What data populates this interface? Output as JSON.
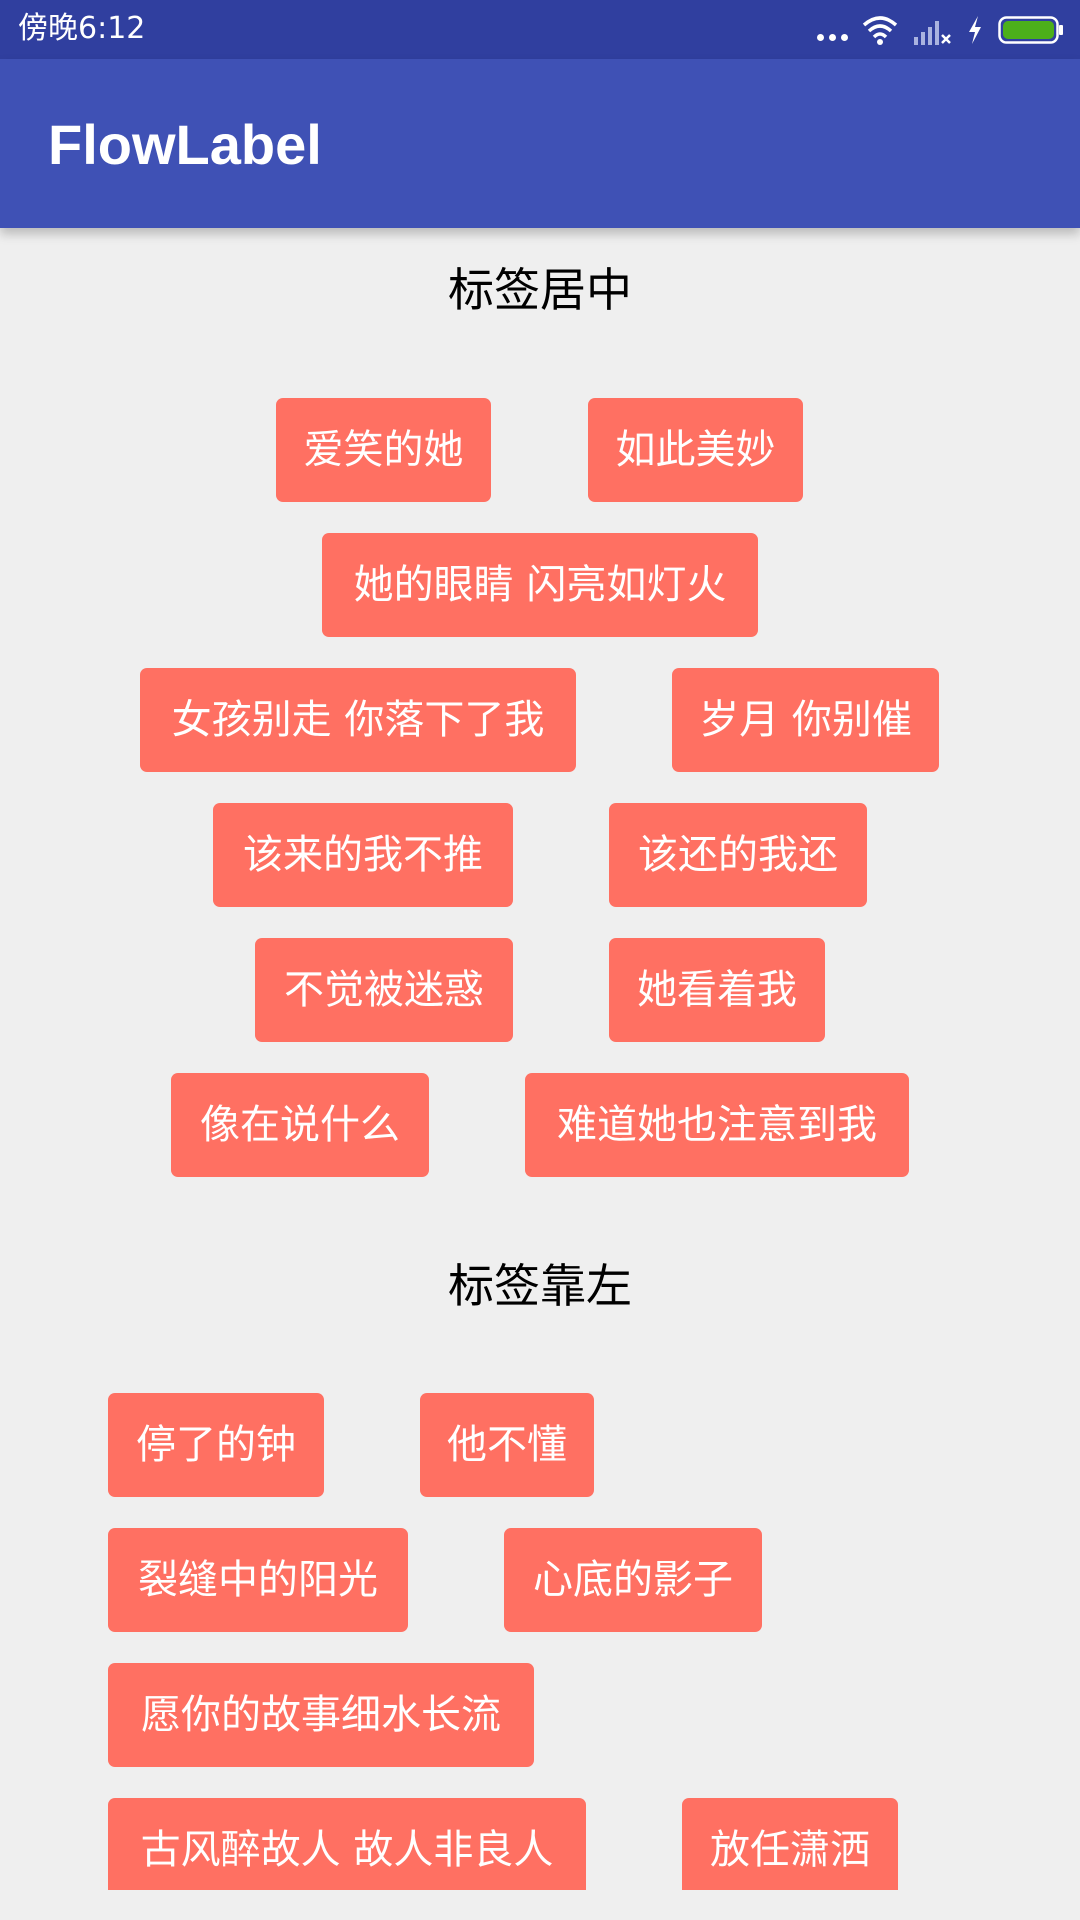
{
  "status_bar": {
    "time": "傍晚6:12",
    "icons": [
      "more-dots-icon",
      "wifi-icon",
      "signal-icon",
      "charging-icon",
      "battery-icon"
    ],
    "battery_color": "#4caf1a"
  },
  "app_bar": {
    "title": "FlowLabel",
    "color": "#3f51b5"
  },
  "sections": {
    "center": {
      "title": "标签居中",
      "tags": [
        "爱笑的她",
        "如此美妙",
        "她的眼睛 闪亮如灯火",
        "女孩别走 你落下了我",
        "岁月 你别催",
        "该来的我不推",
        "该还的我还",
        "不觉被迷惑",
        "她看着我",
        "像在说什么",
        "难道她也注意到我"
      ]
    },
    "left": {
      "title": "标签靠左",
      "tags": [
        "停了的钟",
        "他不懂",
        "裂缝中的阳光",
        "心底的影子",
        "愿你的故事细水长流",
        "古风醉故人 故人非良人",
        "放任潇洒"
      ]
    }
  },
  "tag_color": "#ff7062",
  "background_color": "#efefef"
}
